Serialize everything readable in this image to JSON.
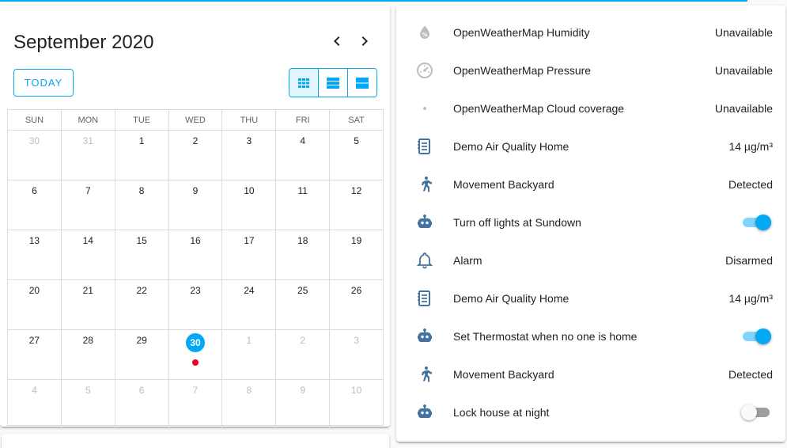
{
  "colors": {
    "accent": "#03a9f4",
    "icon_blue": "#44739e",
    "icon_grey": "#bdbdbd",
    "event_red": "#f0001f"
  },
  "calendar": {
    "title": "September 2020",
    "today_label": "TODAY",
    "prev_icon": "chevron-left-icon",
    "next_icon": "chevron-right-icon",
    "views": [
      "month-view-icon",
      "week-view-icon",
      "day-view-icon"
    ],
    "weekdays": [
      "SUN",
      "MON",
      "TUE",
      "WED",
      "THU",
      "FRI",
      "SAT"
    ],
    "weeks": [
      [
        {
          "d": "30",
          "o": true
        },
        {
          "d": "31",
          "o": true
        },
        {
          "d": "1"
        },
        {
          "d": "2"
        },
        {
          "d": "3"
        },
        {
          "d": "4"
        },
        {
          "d": "5"
        }
      ],
      [
        {
          "d": "6"
        },
        {
          "d": "7"
        },
        {
          "d": "8"
        },
        {
          "d": "9"
        },
        {
          "d": "10"
        },
        {
          "d": "11"
        },
        {
          "d": "12"
        }
      ],
      [
        {
          "d": "13"
        },
        {
          "d": "14"
        },
        {
          "d": "15"
        },
        {
          "d": "16"
        },
        {
          "d": "17"
        },
        {
          "d": "18"
        },
        {
          "d": "19"
        }
      ],
      [
        {
          "d": "20"
        },
        {
          "d": "21"
        },
        {
          "d": "22"
        },
        {
          "d": "23"
        },
        {
          "d": "24"
        },
        {
          "d": "25"
        },
        {
          "d": "26"
        }
      ],
      [
        {
          "d": "27"
        },
        {
          "d": "28"
        },
        {
          "d": "29"
        },
        {
          "d": "30",
          "today": true,
          "event": true
        },
        {
          "d": "1",
          "o": true
        },
        {
          "d": "2",
          "o": true
        },
        {
          "d": "3",
          "o": true
        }
      ],
      [
        {
          "d": "4",
          "o": true
        },
        {
          "d": "5",
          "o": true
        },
        {
          "d": "6",
          "o": true
        },
        {
          "d": "7",
          "o": true
        },
        {
          "d": "8",
          "o": true
        },
        {
          "d": "9",
          "o": true
        },
        {
          "d": "10",
          "o": true
        }
      ]
    ]
  },
  "entities": [
    {
      "icon": "water-percent-icon",
      "name": "OpenWeatherMap Humidity",
      "state": "Unavailable",
      "unavailable": true
    },
    {
      "icon": "gauge-icon",
      "name": "OpenWeatherMap Pressure",
      "state": "Unavailable",
      "unavailable": true
    },
    {
      "icon": "eye-icon",
      "name": "OpenWeatherMap Cloud coverage",
      "state": "Unavailable",
      "unavailable": true
    },
    {
      "icon": "air-quality-icon",
      "name": "Demo Air Quality Home",
      "state": "14 µg/m³"
    },
    {
      "icon": "motion-run-icon",
      "name": "Movement Backyard",
      "state": "Detected"
    },
    {
      "icon": "robot-icon",
      "name": "Turn off lights at Sundown",
      "toggle": true,
      "on": true
    },
    {
      "icon": "bell-icon",
      "name": "Alarm",
      "state": "Disarmed"
    },
    {
      "icon": "air-quality-icon",
      "name": "Demo Air Quality Home",
      "state": "14 µg/m³"
    },
    {
      "icon": "robot-icon",
      "name": "Set Thermostat when no one is home",
      "toggle": true,
      "on": true
    },
    {
      "icon": "motion-run-icon",
      "name": "Movement Backyard",
      "state": "Detected"
    },
    {
      "icon": "robot-icon",
      "name": "Lock house at night",
      "toggle": true,
      "on": false
    }
  ]
}
